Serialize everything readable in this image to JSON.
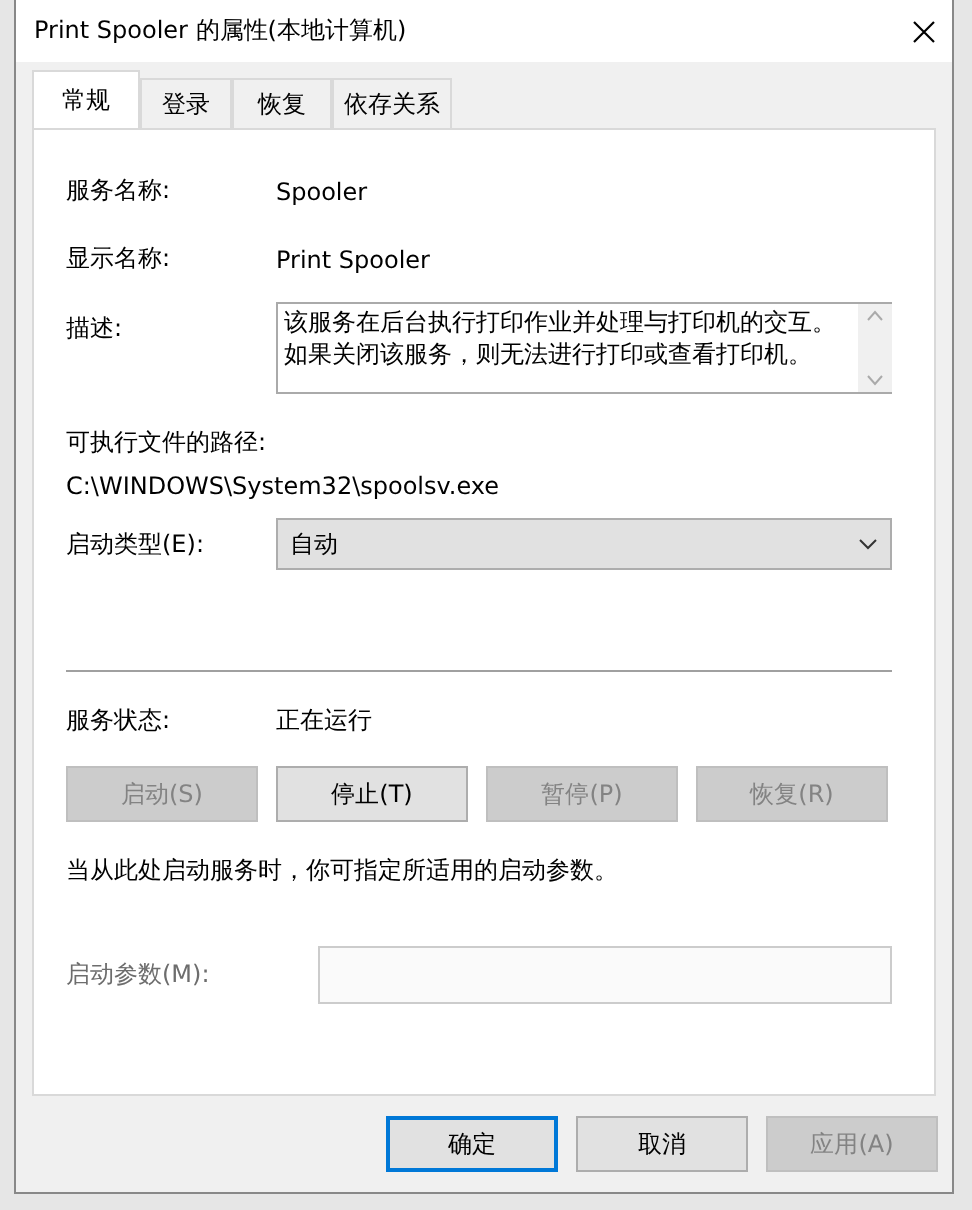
{
  "window": {
    "title": "Print Spooler 的属性(本地计算机)"
  },
  "tabs": [
    {
      "label": "常规",
      "selected": true
    },
    {
      "label": "登录",
      "selected": false
    },
    {
      "label": "恢复",
      "selected": false
    },
    {
      "label": "依存关系",
      "selected": false
    }
  ],
  "fields": [
    {
      "label": "服务名称:",
      "value": "Spooler"
    },
    {
      "label": "显示名称:",
      "value": "Print Spooler"
    }
  ],
  "description": {
    "label": "描述:",
    "value": "该服务在后台执行打印作业并处理与打印机的交互。如果关闭该服务，则无法进行打印或查看打印机。"
  },
  "path": {
    "label": "可执行文件的路径:",
    "value": "C:\\WINDOWS\\System32\\spoolsv.exe"
  },
  "startup_type": {
    "label": "启动类型(E):",
    "value": "自动"
  },
  "status": {
    "label": "服务状态:",
    "value": "正在运行"
  },
  "service_buttons": [
    {
      "label": "启动(S)",
      "disabled": true
    },
    {
      "label": "停止(T)",
      "disabled": false
    },
    {
      "label": "暂停(P)",
      "disabled": true
    },
    {
      "label": "恢复(R)",
      "disabled": true
    }
  ],
  "hint": "当从此处启动服务时，你可指定所适用的启动参数。",
  "start_params": {
    "label": "启动参数(M):",
    "disabled": true
  },
  "dialog_buttons": [
    {
      "label": "确定",
      "focused": true,
      "disabled": false
    },
    {
      "label": "取消",
      "focused": false,
      "disabled": false
    },
    {
      "label": "应用(A)",
      "focused": false,
      "disabled": true
    }
  ]
}
